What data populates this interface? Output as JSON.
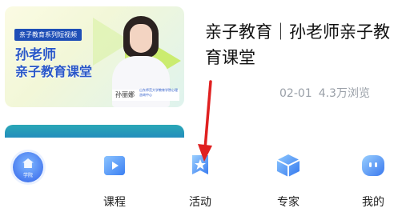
{
  "course_card": {
    "thumbnail": {
      "tag": "亲子教育系列短视频",
      "title_line1": "孙老师",
      "title_line2": "亲子教育课堂",
      "teacher_name": "孙丽娜",
      "teacher_caption": "山东师范大学教育学院心理咨询中心",
      "accent_color": "#2a58c8"
    },
    "title": "亲子教育｜孙老师亲子教育课堂",
    "date": "02-01",
    "views": "4.3万浏览"
  },
  "tabbar": {
    "items": [
      {
        "label": "学院",
        "icon": "home-house-icon",
        "color": "#4a7df0"
      },
      {
        "label": "课程",
        "icon": "play-book-icon",
        "color": "#3b8ef5"
      },
      {
        "label": "活动",
        "icon": "star-flag-icon",
        "color": "#3b8ef5"
      },
      {
        "label": "专家",
        "icon": "cube-box-icon",
        "color": "#3b8ef5"
      },
      {
        "label": "我的",
        "icon": "chat-face-icon",
        "color": "#3b8ef5"
      }
    ]
  },
  "annotation": {
    "arrow_color": "#e02020"
  }
}
